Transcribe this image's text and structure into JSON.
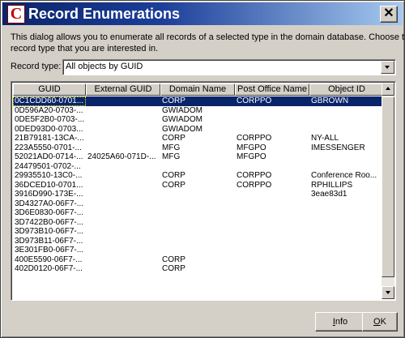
{
  "window": {
    "title": "Record Enumerations",
    "app_icon_letter": "C"
  },
  "description": {
    "line1": "This dialog allows you to enumerate all records of a selected type in the domain database.  Choose the",
    "line2": "record type that you are interested in."
  },
  "record_type": {
    "label": "Record type:",
    "value": "All objects by GUID"
  },
  "table": {
    "columns": [
      "GUID",
      "External GUID",
      "Domain Name",
      "Post Office Name",
      "Object ID"
    ],
    "rows": [
      {
        "guid": "0C1CDD60-0701...",
        "external_guid": "",
        "domain": "CORP",
        "post_office": "CORPPO",
        "object_id": "GBROWN"
      },
      {
        "guid": "0D596A20-0703-...",
        "external_guid": "",
        "domain": "GWIADOM",
        "post_office": "",
        "object_id": ""
      },
      {
        "guid": "0DE5F2B0-0703-...",
        "external_guid": "",
        "domain": "GWIADOM",
        "post_office": "",
        "object_id": ""
      },
      {
        "guid": "0DED93D0-0703...",
        "external_guid": "",
        "domain": "GWIADOM",
        "post_office": "",
        "object_id": ""
      },
      {
        "guid": "21B79181-13CA-...",
        "external_guid": "",
        "domain": "CORP",
        "post_office": "CORPPO",
        "object_id": "NY-ALL"
      },
      {
        "guid": "223A5550-0701-...",
        "external_guid": "",
        "domain": "MFG",
        "post_office": "MFGPO",
        "object_id": "IMESSENGER"
      },
      {
        "guid": "52021AD0-0714-...",
        "external_guid": "24025A60-071D-...",
        "domain": "MFG",
        "post_office": "MFGPO",
        "object_id": ""
      },
      {
        "guid": "24479501-0702-...",
        "external_guid": "",
        "domain": "",
        "post_office": "",
        "object_id": ""
      },
      {
        "guid": "29935510-13C0-...",
        "external_guid": "",
        "domain": "CORP",
        "post_office": "CORPPO",
        "object_id": "Conference Roo..."
      },
      {
        "guid": "36DCED10-0701...",
        "external_guid": "",
        "domain": "CORP",
        "post_office": "CORPPO",
        "object_id": "RPHILLIPS"
      },
      {
        "guid": "3916D990-173E-...",
        "external_guid": "",
        "domain": "",
        "post_office": "",
        "object_id": "3eae83d1"
      },
      {
        "guid": "3D4327A0-06F7-...",
        "external_guid": "",
        "domain": "",
        "post_office": "",
        "object_id": ""
      },
      {
        "guid": "3D6E0830-06F7-...",
        "external_guid": "",
        "domain": "",
        "post_office": "",
        "object_id": ""
      },
      {
        "guid": "3D7422B0-06F7-...",
        "external_guid": "",
        "domain": "",
        "post_office": "",
        "object_id": ""
      },
      {
        "guid": "3D973B10-06F7-...",
        "external_guid": "",
        "domain": "",
        "post_office": "",
        "object_id": ""
      },
      {
        "guid": "3D973B11-06F7-...",
        "external_guid": "",
        "domain": "",
        "post_office": "",
        "object_id": ""
      },
      {
        "guid": "3E301FB0-06F7-...",
        "external_guid": "",
        "domain": "",
        "post_office": "",
        "object_id": ""
      },
      {
        "guid": "400E5590-06F7-...",
        "external_guid": "",
        "domain": "CORP",
        "post_office": "",
        "object_id": ""
      },
      {
        "guid": "402D0120-06F7-...",
        "external_guid": "",
        "domain": "CORP",
        "post_office": "",
        "object_id": ""
      }
    ]
  },
  "buttons": {
    "info": {
      "prefix": "",
      "accel": "I",
      "rest": "nfo"
    },
    "ok": {
      "prefix": "",
      "accel": "O",
      "rest": "K"
    }
  },
  "colors": {
    "title_gradient_start": "#0a246a",
    "title_gradient_end": "#a6caf0",
    "selection": "#0a246a",
    "face": "#d4d0c8",
    "app_icon_red": "#c00000"
  }
}
